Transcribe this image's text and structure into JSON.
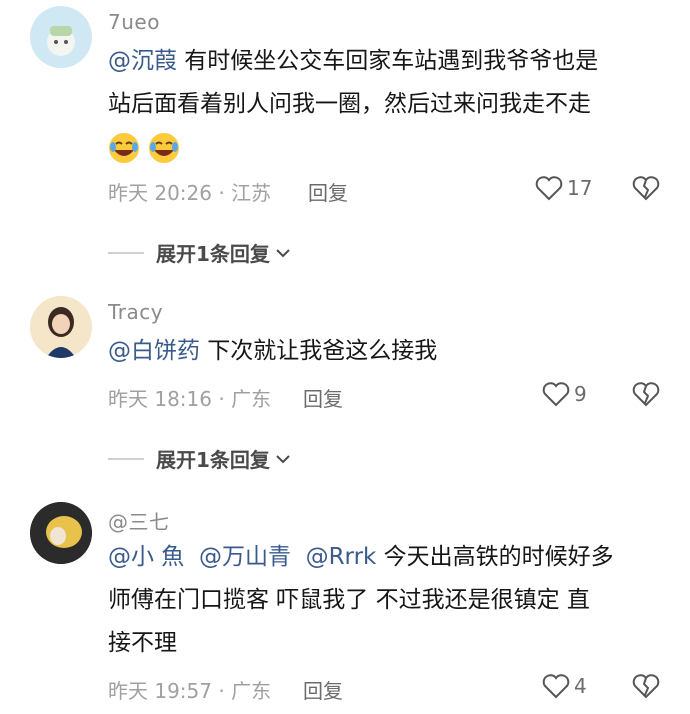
{
  "comments": [
    {
      "username": "7ueo",
      "mention": "@沉葭",
      "text_line1": " 有时候坐公交车回家车站遇到我爷爷也是",
      "text_line2": "站后面看着别人问我一圈，然后过来问我走不走",
      "emojis": [
        "crying-laughing-emoji",
        "crying-laughing-emoji"
      ],
      "meta": "昨天 20:26 · 江苏",
      "reply_label": "回复",
      "likes": "17",
      "expand_label": "展开1条回复"
    },
    {
      "username": "Tracy",
      "mention": "@白饼药",
      "text_line1": " 下次就让我爸这么接我",
      "meta": "昨天 18:16 · 广东",
      "reply_label": "回复",
      "likes": "9",
      "expand_label": "展开1条回复"
    },
    {
      "username": "@三七",
      "mention1": "@小 魚",
      "mention2": "@万山青",
      "mention3": "@Rrrk",
      "text_line1": " 今天出高铁的时候好多",
      "text_line2": "师傅在门口揽客 吓鼠我了 不过我还是很镇定 直",
      "text_line3": "接不理",
      "meta": "昨天 19:57 · 广东",
      "reply_label": "回复",
      "likes": "4"
    }
  ],
  "colors": {
    "mention": "#3a5a8c",
    "meta": "#a0a0a0",
    "username": "#8a8a8a"
  }
}
